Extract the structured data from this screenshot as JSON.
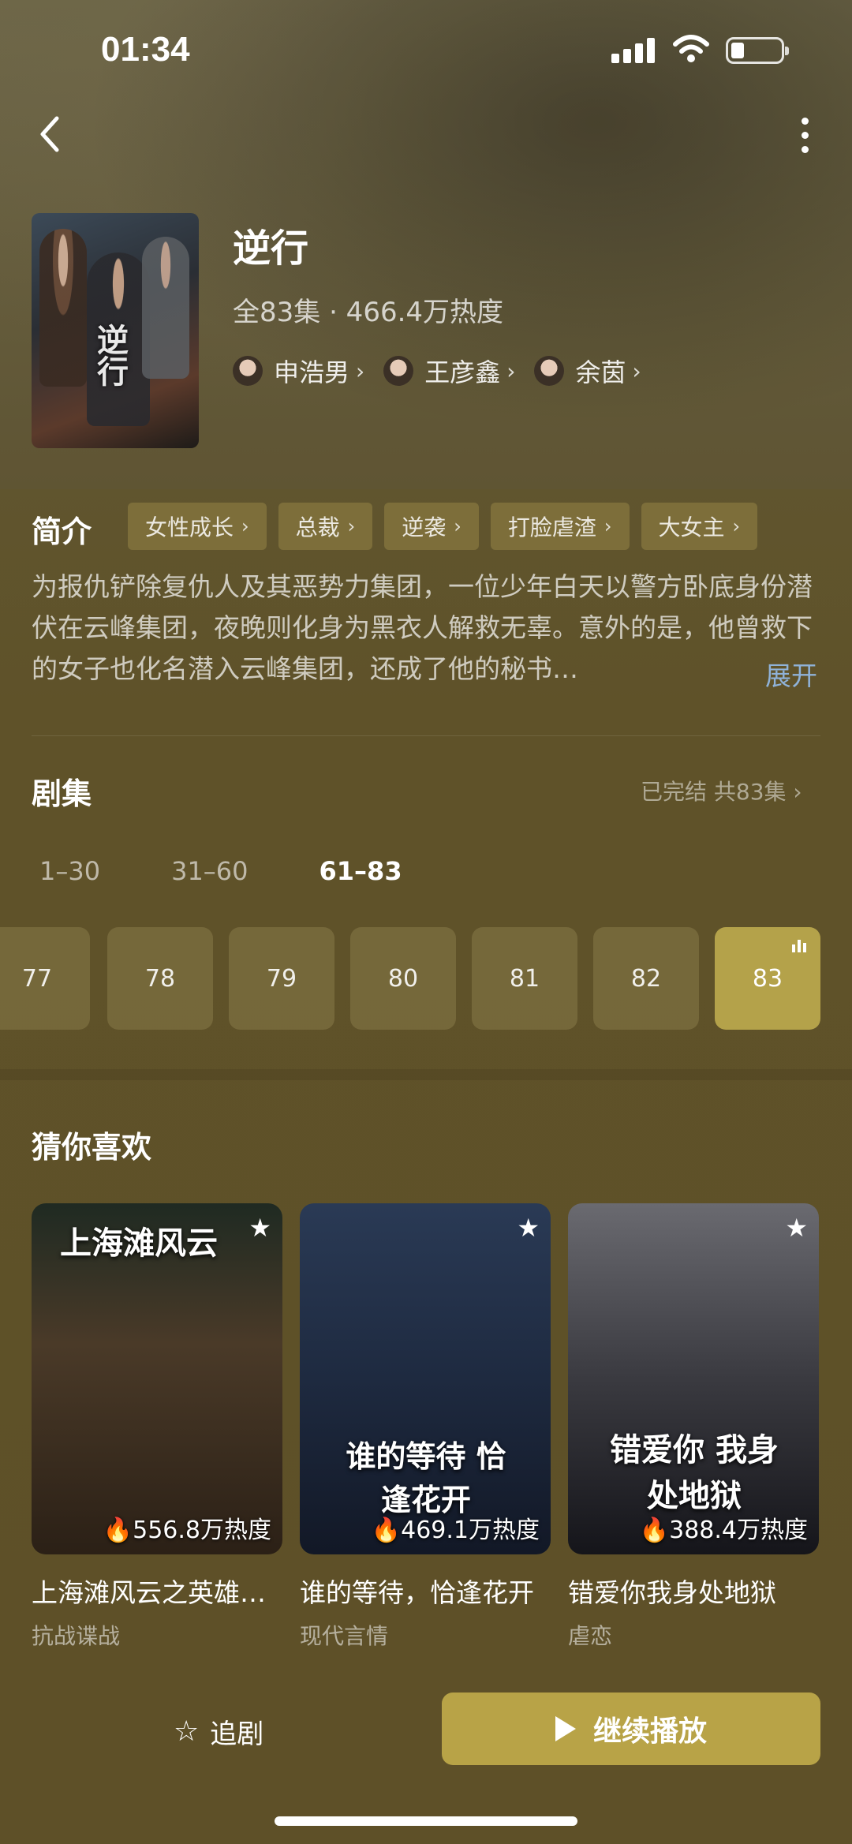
{
  "status_bar": {
    "time": "01:34"
  },
  "header": {
    "back_icon": "chevron-left-icon",
    "more_icon": "more-vertical-icon"
  },
  "show": {
    "poster_text": "逆行",
    "title": "逆行",
    "meta": "全83集 · 466.4万热度",
    "actors": [
      {
        "name": "申浩男"
      },
      {
        "name": "王彦鑫"
      },
      {
        "name": "余茵"
      }
    ]
  },
  "intro": {
    "label": "简介",
    "tags": [
      "女性成长",
      "总裁",
      "逆袭",
      "打脸虐渣",
      "大女主"
    ],
    "description": "为报仇铲除复仇人及其恶势力集团，一位少年白天以警方卧底身份潜伏在云峰集团，夜晚则化身为黑衣人解救无辜。意外的是，他曾救下的女子也化名潜入云峰集团，还成了他的秘书…",
    "expand_label": "展开"
  },
  "episodes": {
    "title": "剧集",
    "status": "已完结 共83集 ›",
    "ranges": [
      "1–30",
      "31–60",
      "61–83"
    ],
    "active_range": 2,
    "items": [
      "77",
      "78",
      "79",
      "80",
      "81",
      "82",
      "83"
    ],
    "current": "83"
  },
  "recommend": {
    "title": "猜你喜欢",
    "items": [
      {
        "art": "上海滩风云",
        "heat": "556.8万热度",
        "name": "上海滩风云之英雄…",
        "genre": "抗战谍战"
      },
      {
        "art": "谁的等待 恰逢花开",
        "heat": "469.1万热度",
        "name": "谁的等待，恰逢花开",
        "genre": "现代言情"
      },
      {
        "art": "错爱你 我身处地狱",
        "heat": "388.4万热度",
        "name": "错爱你我身处地狱",
        "genre": "虐恋"
      }
    ]
  },
  "bottom": {
    "follow_label": "追剧",
    "play_label": "继续播放"
  },
  "colors": {
    "accent": "#b8a347",
    "background": "#5e5028",
    "link": "#8fb2d8"
  }
}
